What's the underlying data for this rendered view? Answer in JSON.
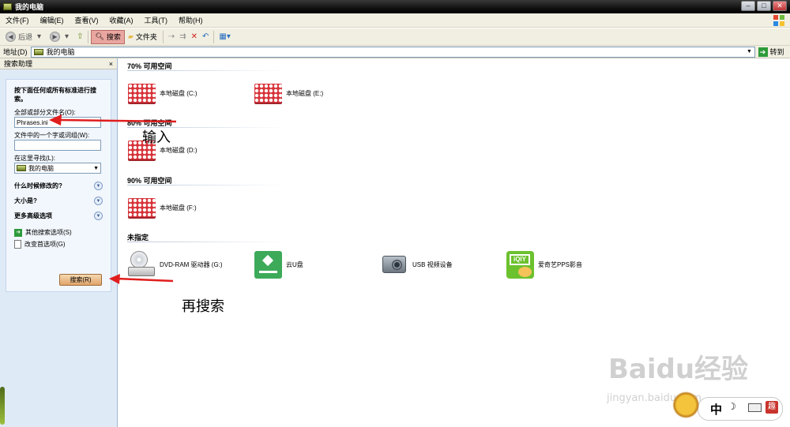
{
  "window": {
    "title": "我的电脑"
  },
  "menu": [
    "文件(F)",
    "编辑(E)",
    "查看(V)",
    "收藏(A)",
    "工具(T)",
    "帮助(H)"
  ],
  "toolbar": {
    "back_label": "后退",
    "search_label": "搜索",
    "folders_label": "文件夹"
  },
  "address": {
    "label": "地址(D)",
    "value": "我的电脑",
    "go_label": "转到"
  },
  "search_pane": {
    "header": "搜索助理",
    "close": "×",
    "instruction": "按下面任何或所有标准进行搜索。",
    "filename_label": "全部或部分文件名(O):",
    "filename_value": "Phrases.ini",
    "phrase_label": "文件中的一个字或词组(W):",
    "phrase_value": "",
    "lookin_label": "在这里寻找(L):",
    "lookin_value": "我的电脑",
    "options": [
      "什么时候修改的?",
      "大小是?",
      "更多高级选项"
    ],
    "links": [
      "其他搜索选项(S)",
      "改变首选项(G)"
    ],
    "search_button": "搜索(R)"
  },
  "groups": [
    {
      "header": "70% 可用空间",
      "items": [
        "本地磁盘 (C:)",
        "本地磁盘 (E:)"
      ]
    },
    {
      "header": "80% 可用空间",
      "items": [
        "本地磁盘 (D:)"
      ]
    },
    {
      "header": "90% 可用空间",
      "items": [
        "本地磁盘 (F:)"
      ]
    },
    {
      "header": "未指定",
      "items": [
        "DVD-RAM 驱动器 (G:)",
        "云U盘",
        "USB 视频设备",
        "爱奇艺PPS影音"
      ]
    }
  ],
  "annotations": {
    "input_note": "输入",
    "search_note": "再搜索"
  },
  "watermark": {
    "brand": "Baidu经验",
    "url": "jingyan.baidu.com"
  },
  "ime": {
    "mode": "中",
    "moon": "☽",
    "tool": "趣"
  },
  "colors": {
    "arrow": "#e01e1e",
    "disk": "#d7333a"
  }
}
